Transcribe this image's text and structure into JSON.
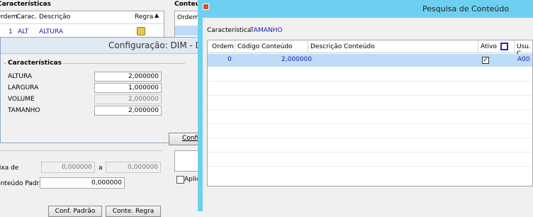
{
  "bg_window": {
    "caracteristicas_title": "Características",
    "conteudo_title": "Conteúdo",
    "columns": {
      "ordem": "Ordem",
      "carac": "Carac.",
      "descricao": "Descrição",
      "regra": "Regra"
    },
    "row": {
      "ordem": "1",
      "carac": "ALT",
      "descricao": "ALTURA"
    },
    "conteudo_ordem_header": "Ordem",
    "faixa_label": "Faixa de",
    "faixa_from": "0,000000",
    "faixa_sep": "a",
    "faixa_to": "0,000000",
    "padrao_label": "Conteúdo Padrão",
    "padrao_value": "0,000000",
    "aplic_label": "Aplic",
    "btn_left": "Conf. Padrão",
    "btn_right": "Conte. Regra"
  },
  "config_dialog": {
    "title": "Configuração: DIM - DIM",
    "group_title": "Características",
    "fields": [
      {
        "label": "ALTURA",
        "value": "2,000000",
        "disabled": false
      },
      {
        "label": "LARGURA",
        "value": "1,000000",
        "disabled": false
      },
      {
        "label": "VOLUME",
        "value": "2,000000",
        "disabled": true
      },
      {
        "label": "TAMANHO",
        "value": "2,000000",
        "disabled": false
      }
    ],
    "confirm_label": "Confi"
  },
  "pesquisa_dialog": {
    "title": "Pesquisa de Conteúdo",
    "caracteristica_label": "Característica",
    "caracteristica_value": "TAMANHO",
    "columns": {
      "ordem": "Ordem",
      "codigo": "Código Conteúdo",
      "descricao": "Descrição Conteúdo",
      "ativo": "Ativo",
      "usu": "Usu. C"
    },
    "rows": [
      {
        "ordem": "0",
        "codigo": "2,000000",
        "descricao": "",
        "ativo": true,
        "usu": "A00"
      }
    ]
  },
  "colors": {
    "titlebar": "#6ed0f1",
    "selected_row": "#bcdcf8",
    "link_blue": "#1a1aa8"
  }
}
